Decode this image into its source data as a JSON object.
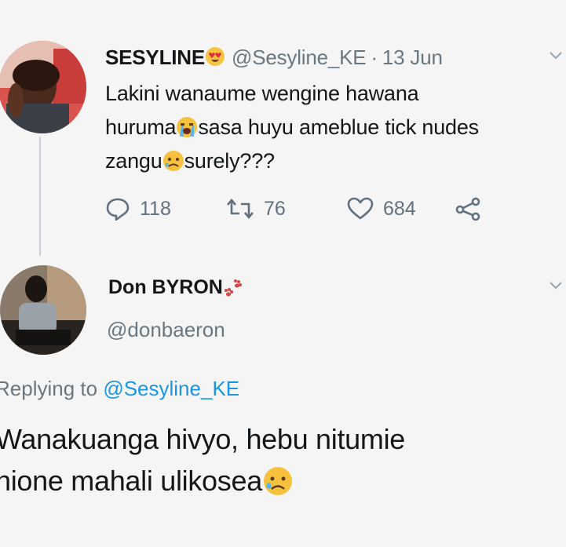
{
  "tweet": {
    "display_name": "SESYLINE",
    "handle": "@Sesyline_KE",
    "separator": "·",
    "date": "13 Jun",
    "text_line1": "Lakini wanaume wengine hawana",
    "text_line2a": "huruma",
    "text_line2b": "sasa huyu ameblue tick nudes",
    "text_line3a": "zangu",
    "text_line3b": "surely???",
    "name_emoji": "heart-eyes-emoji",
    "emoji_1": "crying-face-emoji",
    "emoji_2": "worried-face-emoji",
    "actions": {
      "replies": "118",
      "retweets": "76",
      "likes": "684"
    }
  },
  "reply": {
    "display_name": "Don BYRON",
    "name_emoji": "paw-prints-emoji",
    "handle": "@donbaeron",
    "replying_prefix": "Replying to",
    "replying_handle": "@Sesyline_KE",
    "text_line1": "Wanakuanga hivyo, hebu nitumie",
    "text_line2": "nione mahali ulikosea",
    "emoji": "sad-sweat-face-emoji"
  },
  "colors": {
    "background": "#f4f5f4",
    "text": "#14171a",
    "muted": "#6b7780",
    "link": "#1b95e0",
    "thread_line": "#c9cfd4"
  }
}
